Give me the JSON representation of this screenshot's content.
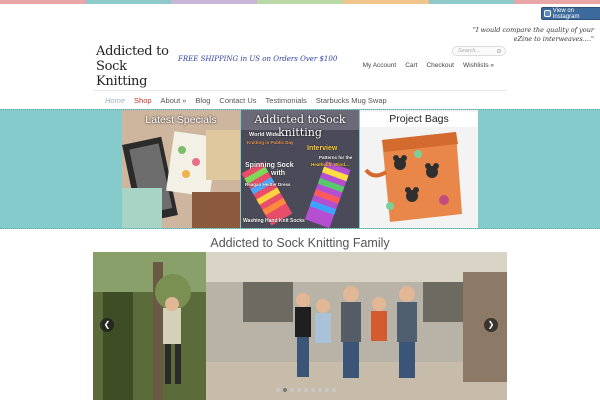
{
  "stripe_colors": [
    "#e8a6a6",
    "#8fc9c9",
    "#c8b6d8",
    "#b9d8a5",
    "#f0c68c",
    "#8fc9c9",
    "#e8a6a6"
  ],
  "instagram_badge": {
    "label": "View on Instagram"
  },
  "header": {
    "quote": "\"I would compare the quality of your eZine to interweaves....\"",
    "logo_line1": "Addicted to",
    "logo_line2": "Sock Knitting",
    "promo": "FREE SHIPPING in US on Orders Over $100",
    "search_placeholder": "Search..."
  },
  "top_nav": [
    "My Account",
    "Cart",
    "Checkout",
    "Wishlists »"
  ],
  "main_nav": {
    "home": "Home",
    "shop": "Shop",
    "about": "About »",
    "blog": "Blog",
    "contact": "Contact Us",
    "testimonials": "Testimonials",
    "swap": "Starbucks Mug Swap"
  },
  "promo_panels": {
    "latest": {
      "title": "Latest Specials"
    },
    "ezine": {
      "title": "Addicted toSock knitting",
      "line1": "World Wide",
      "line2": "Knitting in Public Day",
      "line3": "Spinning Sock",
      "line4": "with",
      "line5": "Reagan Heitter Dress",
      "line6": "Washing Hand Knit Socks",
      "interview": "Interview",
      "interview_sub1": "Patterns for the",
      "interview_sub2": "Heathcliff, Wind..."
    },
    "bags": {
      "title": "Project Bags"
    }
  },
  "family_section": {
    "title": "Addicted to Sock Knitting Family",
    "slide_count": 9,
    "active_slide": 1
  },
  "colors": {
    "band": "#86cbcb",
    "promo_text": "#2f3fa8",
    "shop_active": "#c0392b"
  }
}
